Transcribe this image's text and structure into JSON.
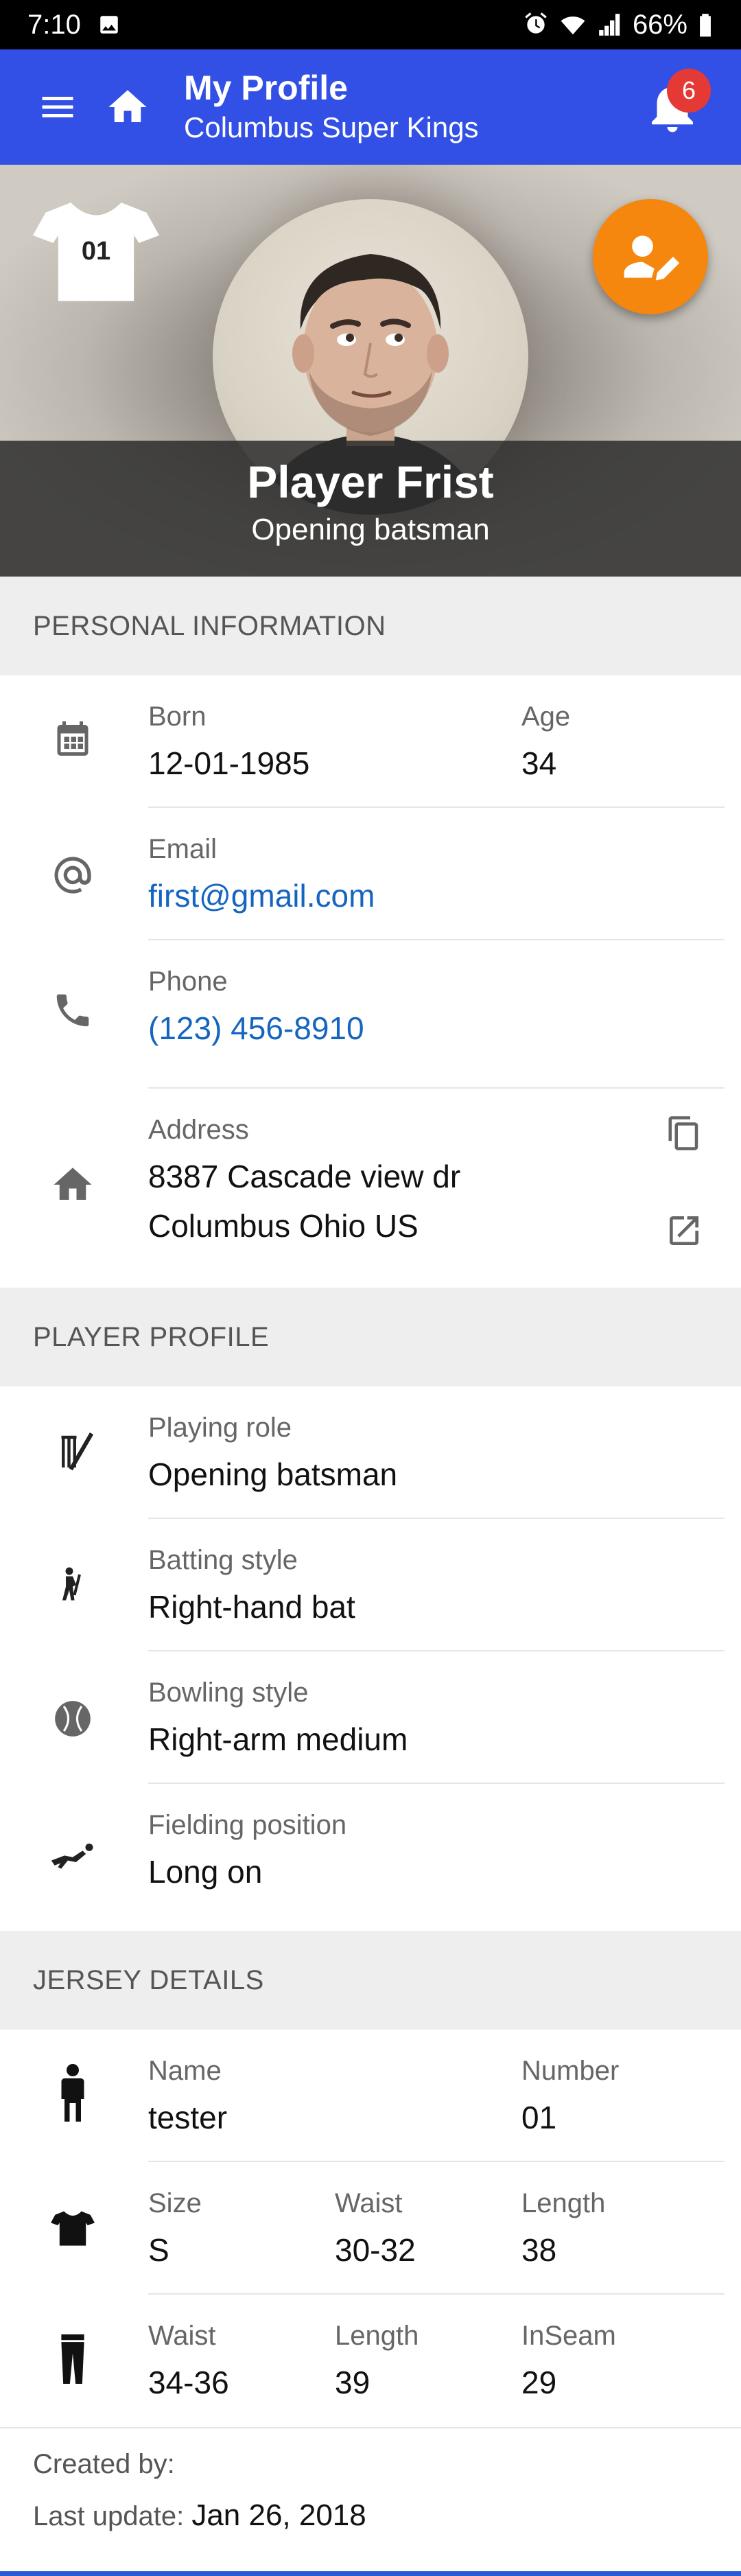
{
  "status": {
    "time": "7:10",
    "battery": "66%"
  },
  "header": {
    "title": "My Profile",
    "subtitle": "Columbus Super Kings",
    "notification_count": "6"
  },
  "hero": {
    "jersey_number": "01",
    "player_name": "Player Frist",
    "player_role": "Opening batsman"
  },
  "personal": {
    "title": "PERSONAL INFORMATION",
    "born_label": "Born",
    "born_value": "12-01-1985",
    "age_label": "Age",
    "age_value": "34",
    "email_label": "Email",
    "email_value": "first@gmail.com",
    "phone_label": "Phone",
    "phone_value": "(123) 456-8910",
    "address_label": "Address",
    "address_line1": "8387 Cascade view dr",
    "address_line2": "Columbus Ohio US"
  },
  "player_profile": {
    "title": "PLAYER PROFILE",
    "playing_role_label": "Playing role",
    "playing_role_value": "Opening batsman",
    "batting_label": "Batting style",
    "batting_value": "Right-hand bat",
    "bowling_label": "Bowling style",
    "bowling_value": "Right-arm medium",
    "fielding_label": "Fielding position",
    "fielding_value": "Long on"
  },
  "jersey": {
    "title": "JERSEY DETAILS",
    "name_label": "Name",
    "name_value": "tester",
    "number_label": "Number",
    "number_value": "01",
    "size_label": "Size",
    "size_value": "S",
    "shirt_waist_label": "Waist",
    "shirt_waist_value": "30-32",
    "shirt_length_label": "Length",
    "shirt_length_value": "38",
    "pant_waist_label": "Waist",
    "pant_waist_value": "34-36",
    "pant_length_label": "Length",
    "pant_length_value": "39",
    "inseam_label": "InSeam",
    "inseam_value": "29"
  },
  "footer": {
    "created_by_label": "Created by:",
    "last_update_label": "Last update:",
    "last_update_value": "Jan 26, 2018"
  }
}
